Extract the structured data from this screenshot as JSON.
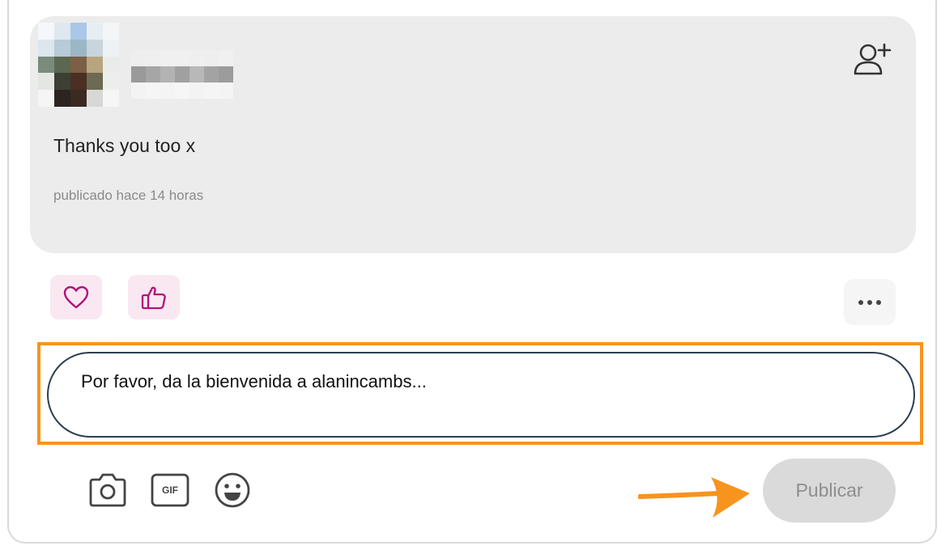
{
  "comment": {
    "text": "Thanks you too x",
    "timestamp": "publicado hace 14 horas",
    "follow_icon": "person-plus-icon"
  },
  "reactions": {
    "heart_icon": "heart-icon",
    "like_icon": "thumbs-up-icon",
    "more_icon": "more-dots-icon",
    "accent_color": "#b0127a"
  },
  "composer": {
    "placeholder": "Por favor, da la bienvenida a alanincambs..."
  },
  "toolbar": {
    "camera_icon": "camera-icon",
    "gif_label": "GIF",
    "emoji_icon": "smiley-icon",
    "publish_label": "Publicar"
  },
  "annotation": {
    "highlight_color": "#f7941d"
  }
}
